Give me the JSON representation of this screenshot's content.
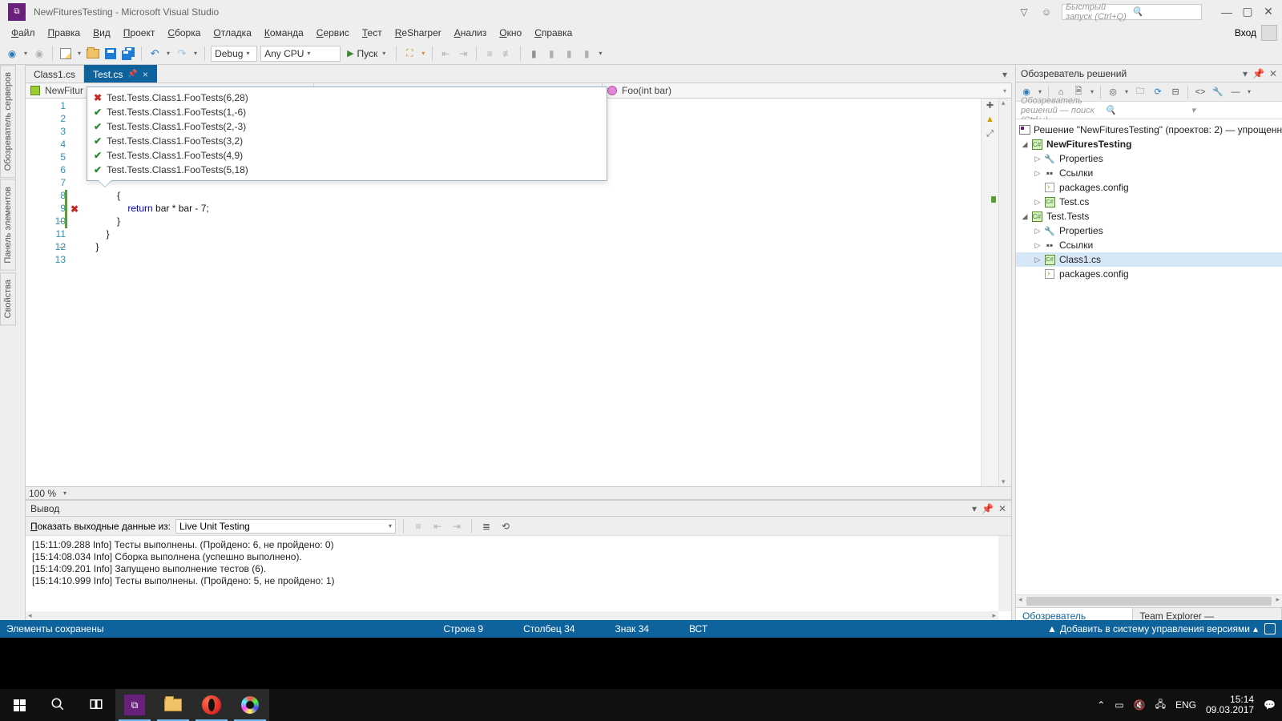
{
  "title": "NewFituresTesting - Microsoft Visual Studio",
  "quick_launch_placeholder": "Быстрый запуск (Ctrl+Q)",
  "login_label": "Вход",
  "menu": [
    "Файл",
    "Правка",
    "Вид",
    "Проект",
    "Сборка",
    "Отладка",
    "Команда",
    "Сервис",
    "Тест",
    "ReSharper",
    "Анализ",
    "Окно",
    "Справка"
  ],
  "toolbar": {
    "config": "Debug",
    "platform": "Any CPU",
    "run": "Пуск"
  },
  "left_tool_tabs": [
    "Обозреватель серверов",
    "Панель элементов",
    "Свойства"
  ],
  "tabs": [
    {
      "label": "Class1.cs",
      "active": false,
      "pinned": false
    },
    {
      "label": "Test.cs",
      "active": true,
      "pinned": true
    }
  ],
  "ctx": {
    "project": "NewFitur",
    "member": "Foo(int bar)"
  },
  "code": {
    "lines": [
      {
        "n": 1,
        "text": ""
      },
      {
        "n": 2,
        "text": ""
      },
      {
        "n": 3,
        "text": ""
      },
      {
        "n": 4,
        "text": ""
      },
      {
        "n": 5,
        "text": ""
      },
      {
        "n": 6,
        "text": ""
      },
      {
        "n": 7,
        "text": ""
      },
      {
        "n": 8,
        "text": "            {",
        "greenbar": true
      },
      {
        "n": 9,
        "text": "                return bar * bar - 7;",
        "greenbar": true,
        "fail": true,
        "caret": true,
        "kw": "return"
      },
      {
        "n": 10,
        "text": "            }",
        "greenbar": true,
        "dash": true
      },
      {
        "n": 11,
        "text": "        }"
      },
      {
        "n": 12,
        "text": "    }",
        "dash": true
      },
      {
        "n": 13,
        "text": ""
      }
    ]
  },
  "test_results": [
    {
      "pass": false,
      "label": "Test.Tests.Class1.FooTests(6,28)"
    },
    {
      "pass": true,
      "label": "Test.Tests.Class1.FooTests(1,-6)"
    },
    {
      "pass": true,
      "label": "Test.Tests.Class1.FooTests(2,-3)"
    },
    {
      "pass": true,
      "label": "Test.Tests.Class1.FooTests(3,2)"
    },
    {
      "pass": true,
      "label": "Test.Tests.Class1.FooTests(4,9)"
    },
    {
      "pass": true,
      "label": "Test.Tests.Class1.FooTests(5,18)"
    }
  ],
  "zoom": "100 %",
  "output": {
    "title": "Вывод",
    "source_label": "Показать выходные данные из:",
    "source_value": "Live Unit Testing",
    "lines": [
      "[15:11:09.288 Info] Тесты выполнены. (Пройдено: 6, не пройдено: 0)",
      "[15:14:08.034 Info] Сборка выполнена (успешно выполнено).",
      "[15:14:09.201 Info] Запущено выполнение тестов (6).",
      "[15:14:10.999 Info] Тесты выполнены. (Пройдено: 5, не пройдено: 1)"
    ]
  },
  "solution_explorer": {
    "title": "Обозреватель решений",
    "search_placeholder": "Обозреватель решений — поиск (Ctrl+;)",
    "solution_line": "Решение \"NewFituresTesting\" (проектов: 2) — упрощенн",
    "projects": [
      {
        "name": "NewFituresTesting",
        "bold": true,
        "children": [
          {
            "name": "Properties",
            "ico": "wrench",
            "expandable": true
          },
          {
            "name": "Ссылки",
            "ico": "ref",
            "expandable": true
          },
          {
            "name": "packages.config",
            "ico": "cfg"
          },
          {
            "name": "Test.cs",
            "ico": "cs",
            "expandable": true
          }
        ]
      },
      {
        "name": "Test.Tests",
        "children": [
          {
            "name": "Properties",
            "ico": "wrench",
            "expandable": true
          },
          {
            "name": "Ссылки",
            "ico": "ref",
            "expandable": true
          },
          {
            "name": "Class1.cs",
            "ico": "cs",
            "expandable": true,
            "selected": true
          },
          {
            "name": "packages.config",
            "ico": "cfg"
          }
        ]
      }
    ],
    "bottom_tabs": [
      "Обозреватель решений",
      "Team Explorer — Подключение"
    ]
  },
  "status": {
    "left": "Элементы сохранены",
    "line": "Строка 9",
    "col": "Столбец 34",
    "char": "Знак 34",
    "mode": "ВСТ",
    "source_control": "Добавить в систему управления версиями"
  },
  "tray": {
    "lang": "ENG",
    "time": "15:14",
    "date": "09.03.2017"
  }
}
